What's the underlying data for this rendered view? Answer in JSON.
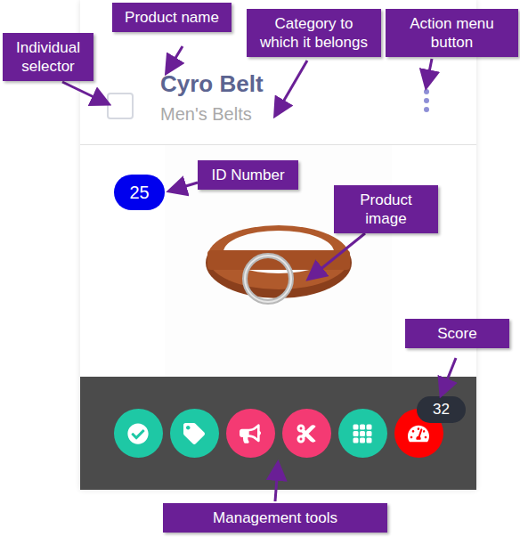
{
  "card": {
    "name": "Cyro Belt",
    "category": "Men's Belts",
    "selected": false,
    "id_badge": "25",
    "score": "32",
    "tools": [
      {
        "kind": "approve",
        "color": "#1ec8a5"
      },
      {
        "kind": "tag",
        "color": "#1ec8a5"
      },
      {
        "kind": "promote",
        "color": "#f43a73"
      },
      {
        "kind": "cut",
        "color": "#f43a73"
      },
      {
        "kind": "grid",
        "color": "#1ec8a5"
      },
      {
        "kind": "score",
        "color": "#ff0000"
      }
    ]
  },
  "callouts": [
    {
      "target": "selector",
      "lines": [
        "Individual",
        "selector"
      ]
    },
    {
      "target": "name",
      "lines": [
        "Product name"
      ]
    },
    {
      "target": "category",
      "lines": [
        "Category to",
        "which it belongs"
      ]
    },
    {
      "target": "menu",
      "lines": [
        "Action menu",
        "button"
      ]
    },
    {
      "target": "id",
      "lines": [
        "ID Number"
      ]
    },
    {
      "target": "image",
      "lines": [
        "Product",
        "image"
      ]
    },
    {
      "target": "score",
      "lines": [
        "Score"
      ]
    },
    {
      "target": "tools",
      "lines": [
        "Management tools"
      ]
    }
  ]
}
